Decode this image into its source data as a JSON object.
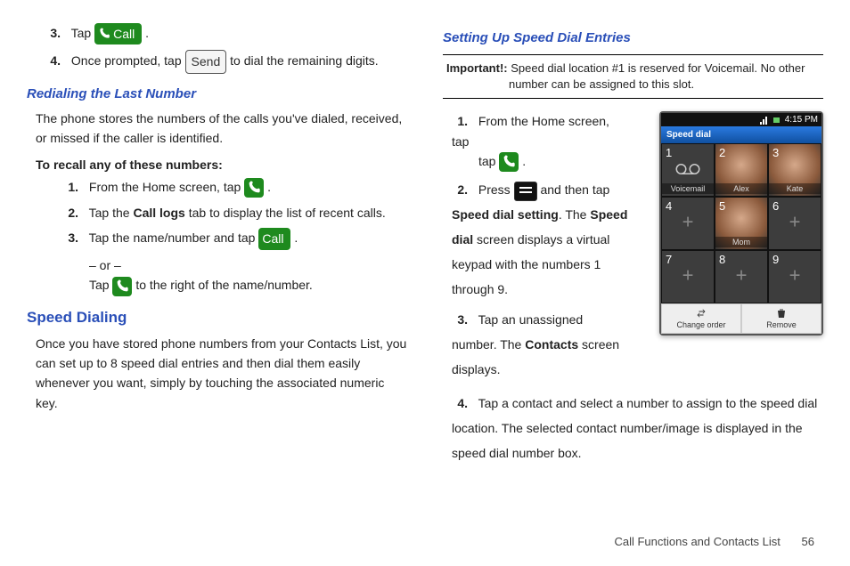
{
  "left": {
    "step3_pre": "Tap ",
    "step3_post": ".",
    "step4_pre": "Once prompted, tap ",
    "step4_post": " to dial the remaining digits.",
    "call_label": "Call",
    "send_label": "Send",
    "sub1": "Redialing the Last Number",
    "para1": "The phone stores the numbers of the calls you've dialed, received, or missed if the caller is identified.",
    "recall_heading": "To recall any of these numbers:",
    "r1_pre": "From the Home screen, tap ",
    "r1_post": " .",
    "r2_pre": "Tap the ",
    "r2_bold": "Call logs",
    "r2_post": " tab to display the list of recent calls.",
    "r3_pre": "Tap the name/number and tap ",
    "r3_post": ".",
    "or": "– or –",
    "r3b_pre": "Tap ",
    "r3b_post": " to the right of the name/number.",
    "heading2": "Speed Dialing",
    "para2": "Once you have stored phone numbers from your Contacts List, you can set up to 8 speed dial entries and then dial them easily whenever you want, simply by touching the associated numeric key."
  },
  "right": {
    "sub2": "Setting Up Speed Dial Entries",
    "important_label": "Important!:",
    "important_text": " Speed dial location #1 is reserved for Voicemail. No other",
    "important_text2": "number can be assigned to this slot.",
    "s1_pre": "From the Home screen, tap ",
    "s1_post": " .",
    "s2_pre": "Press ",
    "s2_mid": " and then tap ",
    "s2_bold1": "Speed dial setting",
    "s2_mid2": ". The ",
    "s2_bold2": "Speed dial",
    "s2_post": " screen displays a virtual keypad with the numbers 1 through 9.",
    "s3_pre": "Tap an unassigned number. The ",
    "s3_bold": "Contacts",
    "s3_post": " screen displays.",
    "s4": "Tap a contact and select a number to assign to the speed dial location. The selected contact number/image is displayed in the speed dial number box."
  },
  "phone": {
    "time": "4:15 PM",
    "header": "Speed dial",
    "cells": [
      {
        "n": "1",
        "label": "Voicemail",
        "type": "vm"
      },
      {
        "n": "2",
        "label": "Alex",
        "type": "avatar"
      },
      {
        "n": "3",
        "label": "Kate",
        "type": "avatar"
      },
      {
        "n": "4",
        "label": "",
        "type": "empty"
      },
      {
        "n": "5",
        "label": "Mom",
        "type": "avatar"
      },
      {
        "n": "6",
        "label": "",
        "type": "empty"
      },
      {
        "n": "7",
        "label": "",
        "type": "empty"
      },
      {
        "n": "8",
        "label": "",
        "type": "empty"
      },
      {
        "n": "9",
        "label": "",
        "type": "empty"
      }
    ],
    "change": "Change order",
    "remove": "Remove"
  },
  "footer": {
    "section": "Call Functions and Contacts List",
    "page": "56"
  }
}
